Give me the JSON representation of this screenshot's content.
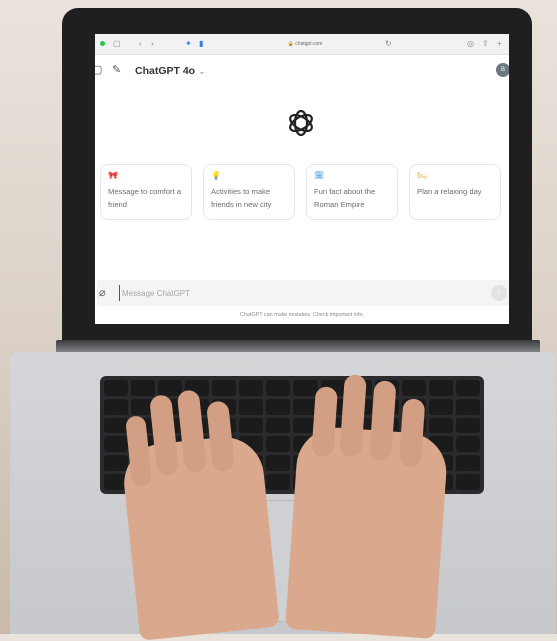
{
  "browser": {
    "url": "chatgpt.com",
    "colors": {
      "close": "#fe5f57",
      "minimize": "#febc2e",
      "zoom": "#28c840",
      "badge": "#e0463b"
    }
  },
  "header": {
    "model_title": "ChatGPT 4o",
    "chevron": "⌄",
    "avatar_initial": "B"
  },
  "suggestions": [
    {
      "icon": "🎀",
      "icon_name": "heart-ribbon-icon",
      "color": "#c27bd6",
      "text": "Message to comfort a friend"
    },
    {
      "icon": "💡",
      "icon_name": "lightbulb-icon",
      "color": "#e0b43c",
      "text": "Activities to make friends in new city"
    },
    {
      "icon": "🗓",
      "icon_name": "calendar-icon",
      "color": "#4da3e0",
      "text": "Fun fact about the Roman Empire"
    },
    {
      "icon": "🛏",
      "icon_name": "bed-icon",
      "color": "#e0b43c",
      "text": "Plan a relaxing day"
    }
  ],
  "composer": {
    "placeholder": "Message ChatGPT",
    "send_icon": "↑"
  },
  "disclaimer": "ChatGPT can make mistakes. Check important info."
}
